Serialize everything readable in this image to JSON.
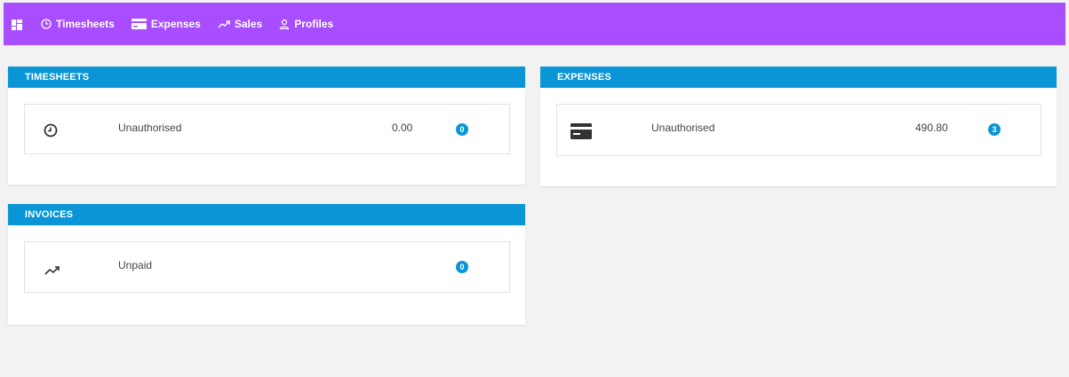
{
  "nav": {
    "dashboard_icon": "dashboard-icon",
    "items": [
      {
        "label": "Timesheets",
        "icon": "clock-icon"
      },
      {
        "label": "Expenses",
        "icon": "credit-card-icon"
      },
      {
        "label": "Sales",
        "icon": "trending-up-icon"
      },
      {
        "label": "Profiles",
        "icon": "user-icon"
      }
    ]
  },
  "cards": {
    "timesheets": {
      "title": "TIMESHEETS",
      "row": {
        "label": "Unauthorised",
        "amount": "0.00",
        "count": "0",
        "icon": "clock-icon"
      }
    },
    "expenses": {
      "title": "EXPENSES",
      "row": {
        "label": "Unauthorised",
        "amount": "490.80",
        "count": "3",
        "icon": "credit-card-icon"
      }
    },
    "invoices": {
      "title": "INVOICES",
      "row": {
        "label": "Unpaid",
        "count": "0",
        "icon": "trending-up-icon"
      }
    }
  },
  "colors": {
    "topbar": "#a84dff",
    "header": "#0a96d6",
    "badge": "#0a96d6",
    "background": "#f2f2f2"
  }
}
